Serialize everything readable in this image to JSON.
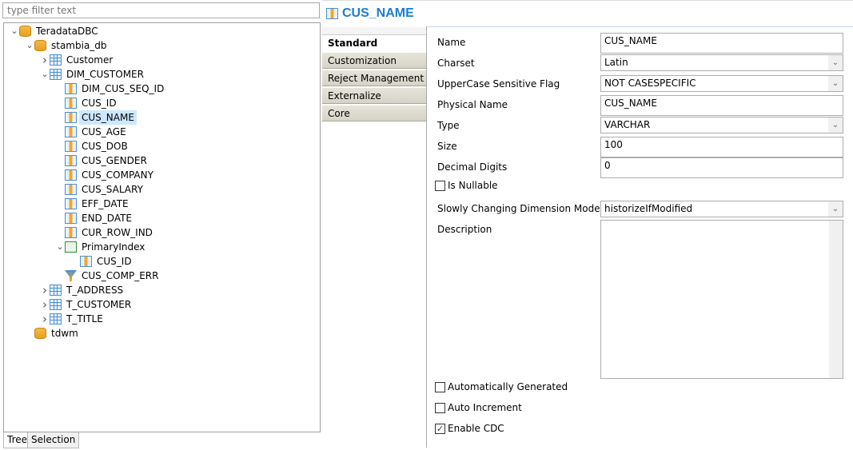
{
  "filter": {
    "placeholder": "type filter text"
  },
  "tree": [
    {
      "label": "TeradataDBC",
      "level": 0,
      "expanded": true,
      "icon": "database-server-icon"
    },
    {
      "label": "stambia_db",
      "level": 1,
      "expanded": true,
      "icon": "schema-icon"
    },
    {
      "label": "Customer",
      "level": 2,
      "expanded": false,
      "icon": "table-icon"
    },
    {
      "label": "DIM_CUSTOMER",
      "level": 2,
      "expanded": true,
      "icon": "table-icon"
    },
    {
      "label": "DIM_CUS_SEQ_ID",
      "level": 3,
      "icon": "column-icon"
    },
    {
      "label": "CUS_ID",
      "level": 3,
      "icon": "column-icon"
    },
    {
      "label": "CUS_NAME",
      "level": 3,
      "icon": "column-icon",
      "selected": true
    },
    {
      "label": "CUS_AGE",
      "level": 3,
      "icon": "column-icon"
    },
    {
      "label": "CUS_DOB",
      "level": 3,
      "icon": "column-icon"
    },
    {
      "label": "CUS_GENDER",
      "level": 3,
      "icon": "column-icon"
    },
    {
      "label": "CUS_COMPANY",
      "level": 3,
      "icon": "column-icon"
    },
    {
      "label": "CUS_SALARY",
      "level": 3,
      "icon": "column-icon"
    },
    {
      "label": "EFF_DATE",
      "level": 3,
      "icon": "column-icon"
    },
    {
      "label": "END_DATE",
      "level": 3,
      "icon": "column-icon"
    },
    {
      "label": "CUR_ROW_IND",
      "level": 3,
      "icon": "column-icon"
    },
    {
      "label": "PrimaryIndex",
      "level": 3,
      "expanded": true,
      "icon": "primary-index-icon"
    },
    {
      "label": "CUS_ID",
      "level": 4,
      "icon": "index-column-icon"
    },
    {
      "label": "CUS_COMP_ERR",
      "level": 3,
      "icon": "filter-icon"
    },
    {
      "label": "T_ADDRESS",
      "level": 2,
      "expanded": false,
      "icon": "table-icon"
    },
    {
      "label": "T_CUSTOMER",
      "level": 2,
      "expanded": false,
      "icon": "table-icon"
    },
    {
      "label": "T_TITLE",
      "level": 2,
      "expanded": false,
      "icon": "table-icon"
    },
    {
      "label": "tdwm",
      "level": 1,
      "icon": "schema-icon"
    }
  ],
  "bottom_tabs": [
    "Tree",
    "Selection"
  ],
  "editor": {
    "title": "CUS_NAME",
    "tabs": [
      "Standard",
      "Customization",
      "Reject Management",
      "Externalize",
      "Core"
    ],
    "active_tab": "Standard",
    "fields": {
      "name": {
        "label": "Name",
        "value": "CUS_NAME"
      },
      "charset": {
        "label": "Charset",
        "value": "Latin"
      },
      "uppercase": {
        "label": "UpperCase Sensitive Flag",
        "value": "NOT CASESPECIFIC"
      },
      "physical": {
        "label": "Physical Name",
        "value": "CUS_NAME"
      },
      "type": {
        "label": "Type",
        "value": "VARCHAR"
      },
      "size": {
        "label": "Size",
        "value": "100"
      },
      "decimal": {
        "label": "Decimal Digits",
        "value": "0"
      },
      "nullable": {
        "label": "Is Nullable",
        "checked": false
      },
      "scd": {
        "label": "Slowly Changing Dimension Mode",
        "value": "historizeIfModified"
      },
      "description": {
        "label": "Description",
        "value": ""
      },
      "auto_gen": {
        "label": "Automatically Generated",
        "checked": false
      },
      "auto_inc": {
        "label": "Auto Increment",
        "checked": false
      },
      "cdc": {
        "label": "Enable CDC",
        "checked": true
      }
    }
  },
  "colors": {
    "accent": "#1a7dd6",
    "selection": "#cce8ff"
  }
}
